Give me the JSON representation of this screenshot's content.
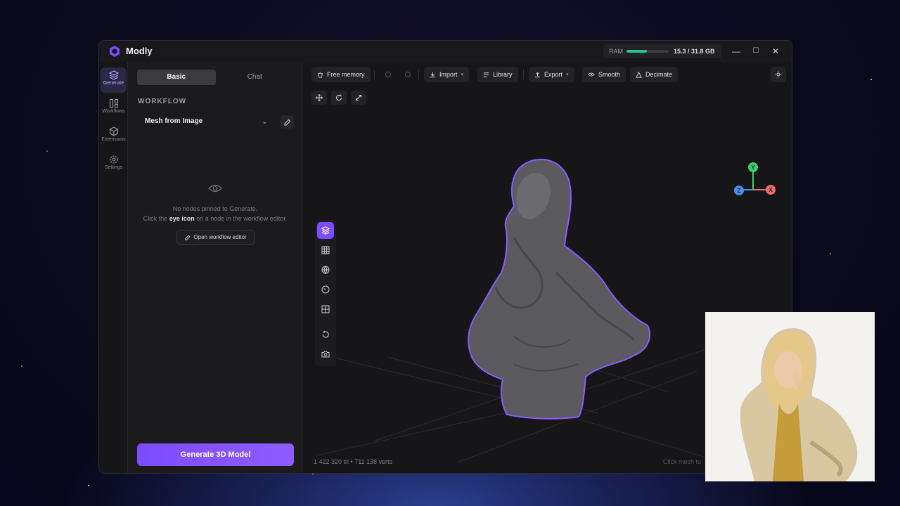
{
  "app": {
    "title": "Modly",
    "ram_label": "RAM",
    "ram_value": "15.3 / 31.8 GB",
    "ram_usage_fraction": 0.48,
    "accent_color": "#7c4dff",
    "ram_color": "#22c58a"
  },
  "window_controls": {
    "minimize": "—",
    "maximize": "☐",
    "close": "✕"
  },
  "nav": [
    {
      "label": "Generate",
      "icon": "layers-icon",
      "active": true
    },
    {
      "label": "Workflows",
      "icon": "workflows-icon",
      "active": false
    },
    {
      "label": "Extensions",
      "icon": "cube-icon",
      "active": false
    },
    {
      "label": "Settings",
      "icon": "gear-icon",
      "active": false
    }
  ],
  "panel": {
    "tabs": [
      "Basic",
      "Chat"
    ],
    "active_tab": "Basic",
    "section_label": "WORKFLOW",
    "workflow_value": "Mesh from Image",
    "empty_line1": "No nodes pinned to Generate.",
    "empty_line2_pre": "Click the",
    "empty_line2_bold": "eye icon",
    "empty_line2_post": "on a node in the workflow editor.",
    "open_editor_label": "Open workflow editor",
    "generate_label": "Generate 3D Model"
  },
  "toolbar": {
    "free_memory": "Free memory",
    "import": "Import",
    "library": "Library",
    "export": "Export",
    "smooth": "Smooth",
    "decimate": "Decimate"
  },
  "axes": {
    "y": "Y",
    "x": "X",
    "z": "Z"
  },
  "viewport": {
    "stats": "1 422 320 tri • 711 138 verts",
    "hint": "Click mesh to"
  }
}
